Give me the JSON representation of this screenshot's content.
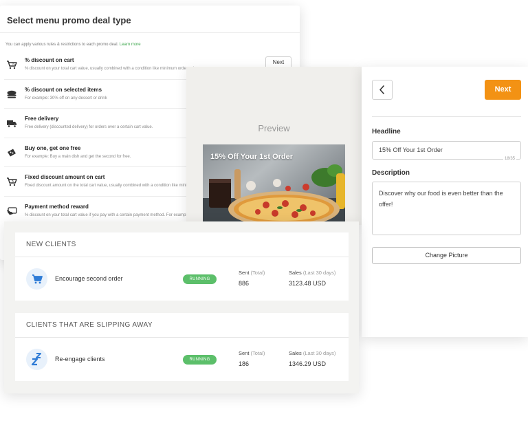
{
  "deal_panel": {
    "title": "Select menu promo deal type",
    "intro": "You can apply various rules & restrictions to each promo deal.",
    "intro_link": "Learn more",
    "next_label": "Next",
    "items": [
      {
        "icon": "cart-percent-icon",
        "name": "% discount on cart",
        "desc": "% discount on your total cart value, usually combined with a condition like minimum order value."
      },
      {
        "icon": "dish-icon",
        "name": "% discount on selected items",
        "desc": "For example: 30% off on any dessert or drink"
      },
      {
        "icon": "delivery-truck-icon",
        "name": "Free delivery",
        "desc": "Free delivery (discounted delivery) for orders over a certain cart value."
      },
      {
        "icon": "ticket-icon",
        "name": "Buy one, get one free",
        "desc": "For example: Buy a main dish and get the second for free."
      },
      {
        "icon": "cart-dollar-icon",
        "name": "Fixed discount amount on cart",
        "desc": "Fixed discount amount on the total cart value, usually combined with a condition like minimum order value."
      },
      {
        "icon": "card-icon",
        "name": "Payment method reward",
        "desc": "% discount on your total cart value if you pay with a certain payment method. For example: pay online"
      }
    ]
  },
  "preview": {
    "label": "Preview",
    "headline": "15% Off Your 1st Order"
  },
  "form": {
    "next_label": "Next",
    "headline_label": "Headline",
    "headline_value": "15% Off Your 1st Order",
    "char_count": "18/35",
    "description_label": "Description",
    "description_value": "Discover why our food is even better than the offer!",
    "change_picture_label": "Change Picture",
    "accent_color": "#f39214"
  },
  "campaigns": {
    "sections": [
      {
        "header": "NEW CLIENTS",
        "row": {
          "icon": "shopping-cart-icon",
          "name": "Encourage second order",
          "status": "RUNNING",
          "sent_label": "Sent",
          "sent_qualifier": "(Total)",
          "sent_value": "886",
          "sales_label": "Sales",
          "sales_qualifier": "(Last 30 days)",
          "sales_value": "3123.48 USD"
        }
      },
      {
        "header": "CLIENTS THAT ARE SLIPPING AWAY",
        "row": {
          "icon": "sleep-zz-icon",
          "name": "Re-engage clients",
          "status": "RUNNING",
          "sent_label": "Sent",
          "sent_qualifier": "(Total)",
          "sent_value": "186",
          "sales_label": "Sales",
          "sales_qualifier": "(Last 30 days)",
          "sales_value": "1346.29 USD"
        }
      }
    ],
    "status_color": "#5cbf6a"
  }
}
